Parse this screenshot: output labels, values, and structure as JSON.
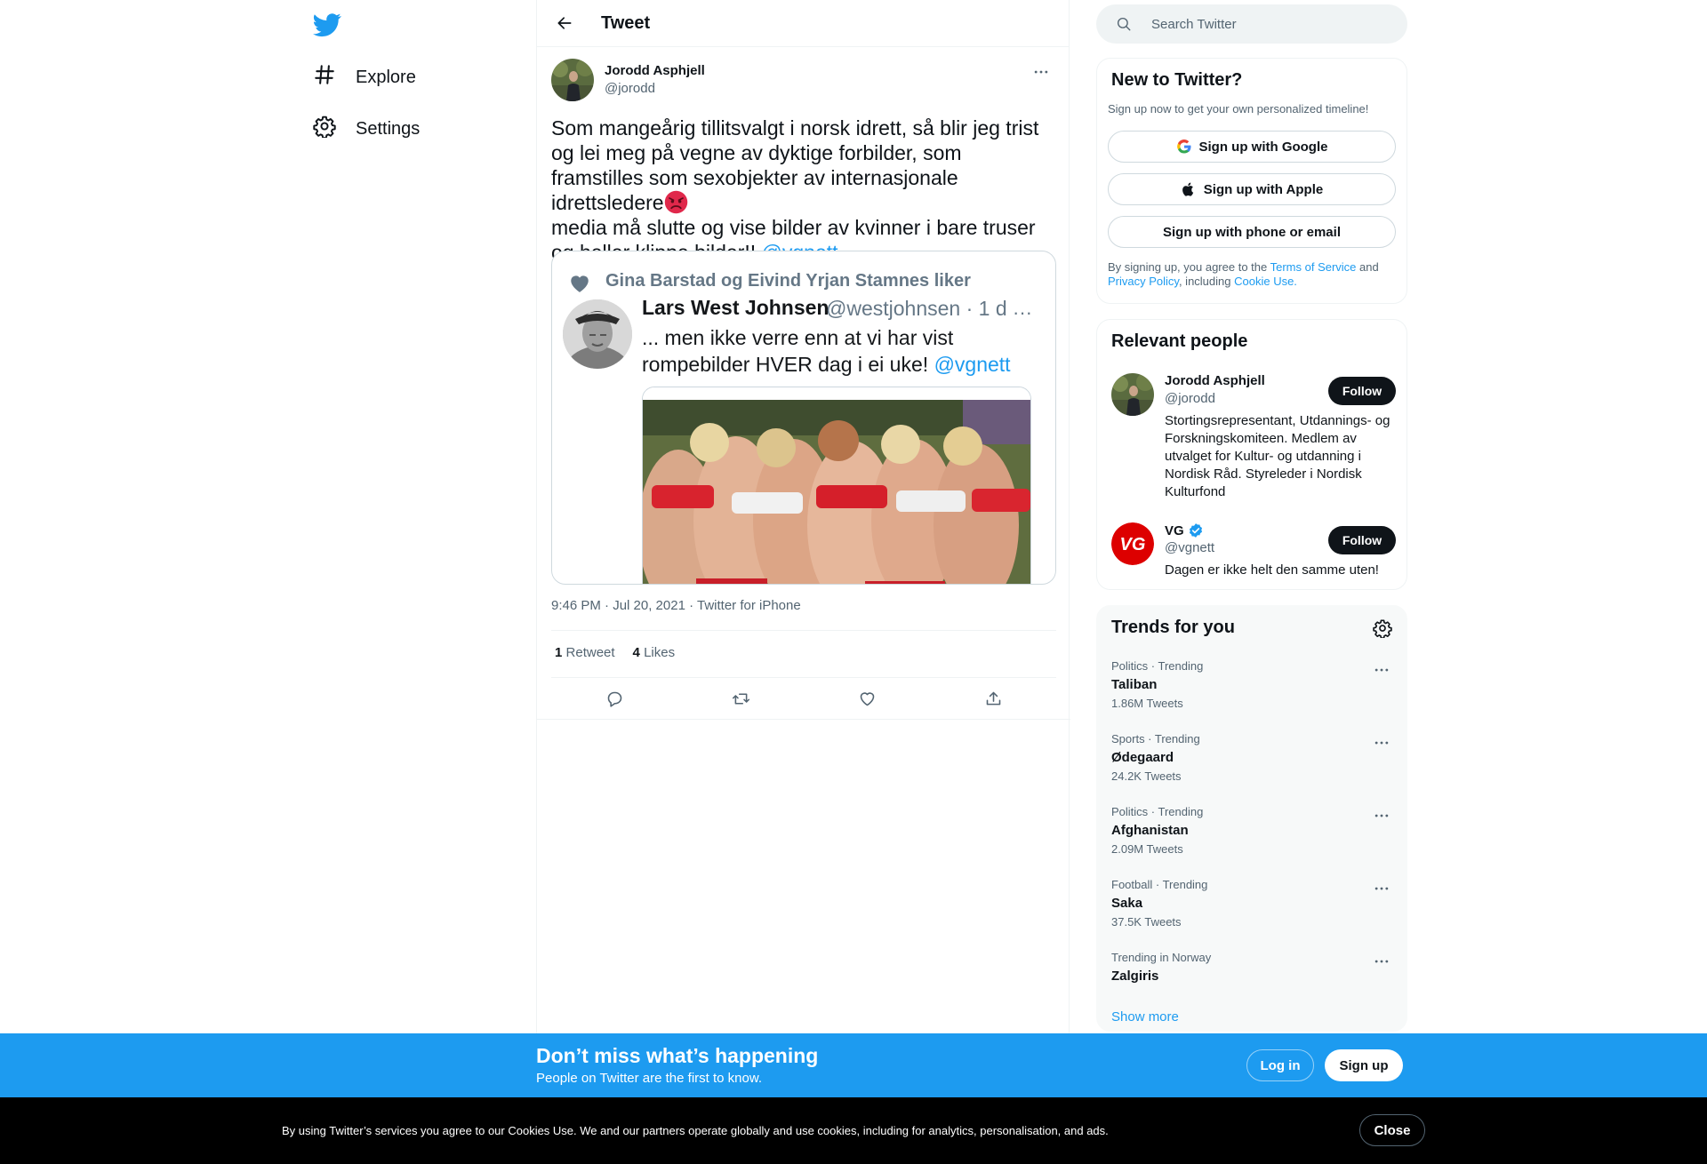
{
  "nav": {
    "items": [
      {
        "label": "Explore",
        "icon": "hashtag-icon"
      },
      {
        "label": "Settings",
        "icon": "gear-icon"
      }
    ]
  },
  "header": {
    "title": "Tweet"
  },
  "tweet": {
    "author_name": "Jorodd Asphjell",
    "author_handle": "@jorodd",
    "text_part1": "Som mangeårig tillitsvalgt i norsk idrett, så blir jeg trist og lei meg på vegne av dyktige forbilder, som framstilles som sexobjekter av internasjonale idrettsledere",
    "text_part2": "media må slutte og vise bilder av kvinner i bare truser og heller klippe bilder!! ",
    "mention": "@vgnett",
    "emoji": "angry-face-emoji",
    "timestamp": "9:46 PM · Jul 20, 2021 · Twitter for iPhone",
    "retweets_count": "1",
    "retweets_label": "Retweet",
    "likes_count": "4",
    "likes_label": "Likes"
  },
  "embedded": {
    "liked_line": "Gina Barstad og Eivind Yrjan Stamnes liker",
    "name": "Lars West Johnsen",
    "handle_time": "@westjohnsen · 1 d",
    "more": "···",
    "text": "... men ikke verre enn at vi har vist rompebilder HVER dag i ei uke! ",
    "mention": "@vgnett"
  },
  "search": {
    "placeholder": "Search Twitter"
  },
  "signup_card": {
    "title": "New to Twitter?",
    "subtitle": "Sign up now to get your own personalized timeline!",
    "google": "Sign up with Google",
    "apple": "Sign up with Apple",
    "phone": "Sign up with phone or email",
    "legal_1": "By signing up, you agree to the ",
    "terms": "Terms of Service",
    "legal_2": " and ",
    "privacy": "Privacy Policy",
    "legal_3": ", including ",
    "cookie": "Cookie Use."
  },
  "people": {
    "title": "Relevant people",
    "items": [
      {
        "name": "Jorodd Asphjell",
        "handle": "@jorodd",
        "bio": "Stortingsrepresentant, Utdannings- og Forskningskomiteen. Medlem av utvalget for Kultur- og utdanning i Nordisk Råd. Styreleder i Nordisk Kulturfond",
        "button": "Follow",
        "verified": false
      },
      {
        "name": "VG",
        "handle": "@vgnett",
        "bio": "Dagen er ikke helt den samme uten!",
        "button": "Follow",
        "verified": true,
        "logo_text": "VG"
      }
    ]
  },
  "trends": {
    "title": "Trends for you",
    "items": [
      {
        "context": "Politics · Trending",
        "name": "Taliban",
        "count": "1.86M Tweets"
      },
      {
        "context": "Sports · Trending",
        "name": "Ødegaard",
        "count": "24.2K Tweets"
      },
      {
        "context": "Politics · Trending",
        "name": "Afghanistan",
        "count": "2.09M Tweets"
      },
      {
        "context": "Football · Trending",
        "name": "Saka",
        "count": "37.5K Tweets"
      },
      {
        "context": "Trending in Norway",
        "name": "Zalgiris",
        "count": ""
      }
    ],
    "show_more": "Show more"
  },
  "signup_bar": {
    "heading": "Don’t miss what’s happening",
    "sub": "People on Twitter are the first to know.",
    "login": "Log in",
    "signup": "Sign up"
  },
  "cookie_bar": {
    "text": "By using Twitter’s services you agree to our Cookies Use. We and our partners operate globally and use cookies, including for analytics, personalisation, and ads.",
    "close": "Close"
  },
  "colors": {
    "accent": "#1d9bf0",
    "text": "#0f1419",
    "secondary": "#536471",
    "border": "#eff3f4"
  }
}
